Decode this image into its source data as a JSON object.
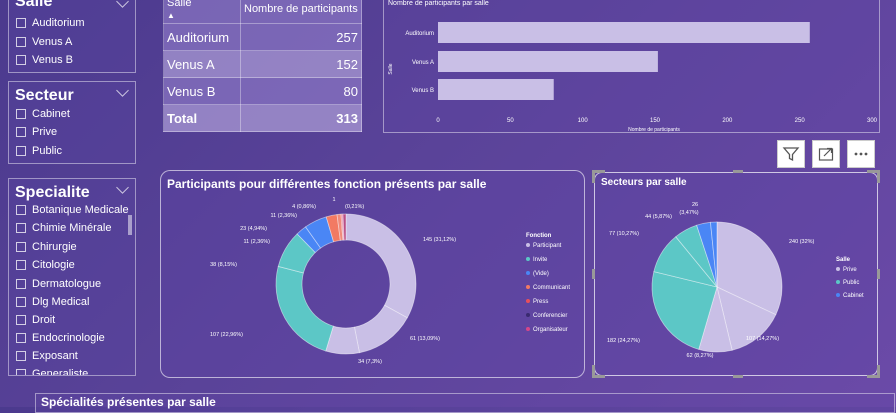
{
  "slicers": {
    "salle": {
      "title": "Salle",
      "items": [
        "Auditorium",
        "Venus A",
        "Venus B"
      ]
    },
    "secteur": {
      "title": "Secteur",
      "items": [
        "Cabinet",
        "Prive",
        "Public"
      ]
    },
    "specialite": {
      "title": "Specialite",
      "items": [
        "Botanique Medicale",
        "Chimie Minérale",
        "Chirurgie",
        "Citologie",
        "Dermatologue",
        "Dlg Medical",
        "Droit",
        "Endocrinologie",
        "Exposant",
        "Generaliste"
      ]
    }
  },
  "table": {
    "col1": "Salle",
    "col2": "Nombre de participants",
    "rows": [
      {
        "salle": "Auditorium",
        "value": "257"
      },
      {
        "salle": "Venus A",
        "value": "152"
      },
      {
        "salle": "Venus B",
        "value": "80"
      }
    ],
    "total_label": "Total",
    "total_value": "313"
  },
  "chart_data": [
    {
      "type": "bar",
      "title": "Nombre de participants par salle",
      "categories": [
        "Auditorium",
        "Venus A",
        "Venus B"
      ],
      "values": [
        257,
        152,
        80
      ],
      "ylabel": "Salle",
      "xlabel": "Nombre de participants",
      "xlim": [
        0,
        300
      ],
      "ticks": [
        "0",
        "50",
        "100",
        "150",
        "200",
        "250",
        "300"
      ]
    },
    {
      "type": "pie",
      "title": "Participants pour différentes fonction présents par salle",
      "legend_title": "Fonction",
      "legend": [
        "Participant",
        "Invite",
        "(Vide)",
        "Communicant",
        "Press",
        "Conferencier",
        "Organisateur"
      ],
      "slices": [
        {
          "value": 145,
          "label": "145 (31,12%)",
          "color": "#c9bfe6"
        },
        {
          "value": 61,
          "label": "61 (13,09%)",
          "color": "#c9bfe6"
        },
        {
          "value": 34,
          "label": "34 (7,3%)",
          "color": "#c9bfe6"
        },
        {
          "value": 107,
          "label": "107 (22,96%)",
          "color": "#5cc7c6"
        },
        {
          "value": 38,
          "label": "38 (8,15%)",
          "color": "#5cc7c6"
        },
        {
          "value": 11,
          "label": "11 (2,36%)",
          "color": "#4a86f5"
        },
        {
          "value": 23,
          "label": "23 (4,94%)",
          "color": "#4a86f5"
        },
        {
          "value": 11,
          "label": "11 (2,36%)",
          "color": "#f27a63"
        },
        {
          "value": 4,
          "label": "4 (0,86%)",
          "color": "#f08a7a"
        },
        {
          "value": 1,
          "label": "1",
          "color": "#e8505b"
        },
        {
          "value": 1,
          "label": "(0,21%)",
          "color": "#d6478a"
        },
        {
          "value": 3,
          "label": "",
          "color": "#b94f87"
        }
      ]
    },
    {
      "type": "pie",
      "title": "Secteurs par salle",
      "legend_title": "Salle",
      "legend": [
        "Prive",
        "Public",
        "Cabinet"
      ],
      "slices": [
        {
          "value": 240,
          "label": "240 (32%)",
          "color": "#c9bfe6"
        },
        {
          "value": 107,
          "label": "107 (14,27%)",
          "color": "#c9bfe6"
        },
        {
          "value": 62,
          "label": "62 (8,27%)",
          "color": "#c9bfe6"
        },
        {
          "value": 182,
          "label": "182 (24,27%)",
          "color": "#5cc7c6"
        },
        {
          "value": 77,
          "label": "77 (10,27%)",
          "color": "#5cc7c6"
        },
        {
          "value": 44,
          "label": "44 (5,87%)",
          "color": "#5cc7c6"
        },
        {
          "value": 26,
          "label": "26",
          "color": "#4a86f5"
        },
        {
          "value": 12,
          "label": "(3,47%)",
          "color": "#4a86f5"
        }
      ]
    }
  ],
  "legend_colors": {
    "Participant": "#c9bfe6",
    "Invite": "#5cc7c6",
    "(Vide)": "#4a86f5",
    "Communicant": "#f27a63",
    "Press": "#e8505b",
    "Conferencier": "#3a2a70",
    "Organisateur": "#d6478a",
    "Prive": "#c9bfe6",
    "Public": "#5cc7c6",
    "Cabinet": "#4a86f5"
  },
  "bottom": {
    "title": "Spécialités présentes par salle"
  },
  "toolbar": {
    "icons": [
      "filter-icon",
      "focus-mode-icon",
      "more-options-icon"
    ]
  }
}
